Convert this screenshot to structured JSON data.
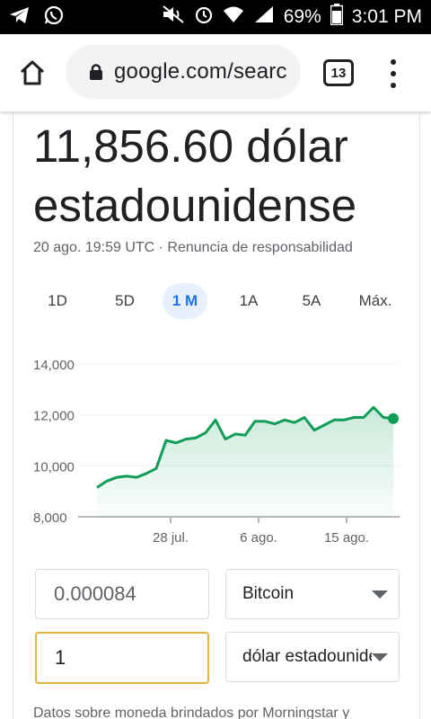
{
  "status_bar": {
    "battery": "69%",
    "time": "3:01 PM"
  },
  "browser": {
    "url": "google.com/searc",
    "tab_count": "13"
  },
  "result": {
    "value_line1": "11,856.60 dólar",
    "value_line2": "estadounidense",
    "timestamp": "20 ago. 19:59 UTC · Renuncia de responsabilidad"
  },
  "ranges": [
    {
      "label": "1D",
      "active": false
    },
    {
      "label": "5D",
      "active": false
    },
    {
      "label": "1 M",
      "active": true
    },
    {
      "label": "1A",
      "active": false
    },
    {
      "label": "5A",
      "active": false
    },
    {
      "label": "Máx.",
      "active": false
    }
  ],
  "chart_data": {
    "type": "area",
    "y_ticks": [
      "14,000",
      "12,000",
      "10,000",
      "8,000"
    ],
    "ylim": [
      8000,
      14000
    ],
    "x_ticks": [
      "28 jul.",
      "6 ago.",
      "15 ago."
    ],
    "series": [
      {
        "values": [
          9150,
          9400,
          9550,
          9600,
          9550,
          9700,
          9900,
          11000,
          10900,
          11050,
          11100,
          11300,
          11800,
          11050,
          11250,
          11200,
          11750,
          11750,
          11650,
          11800,
          11700,
          11900,
          11400,
          11600,
          11800,
          11800,
          11900,
          11900,
          12300,
          11900,
          11856
        ]
      }
    ],
    "accent": "#0f9d58"
  },
  "converter": {
    "from_value": "0.000084",
    "from_currency": "Bitcoin",
    "to_value": "1",
    "to_currency": "dólar estadounidense"
  },
  "footer": "Datos sobre moneda brindados por Morningstar y"
}
